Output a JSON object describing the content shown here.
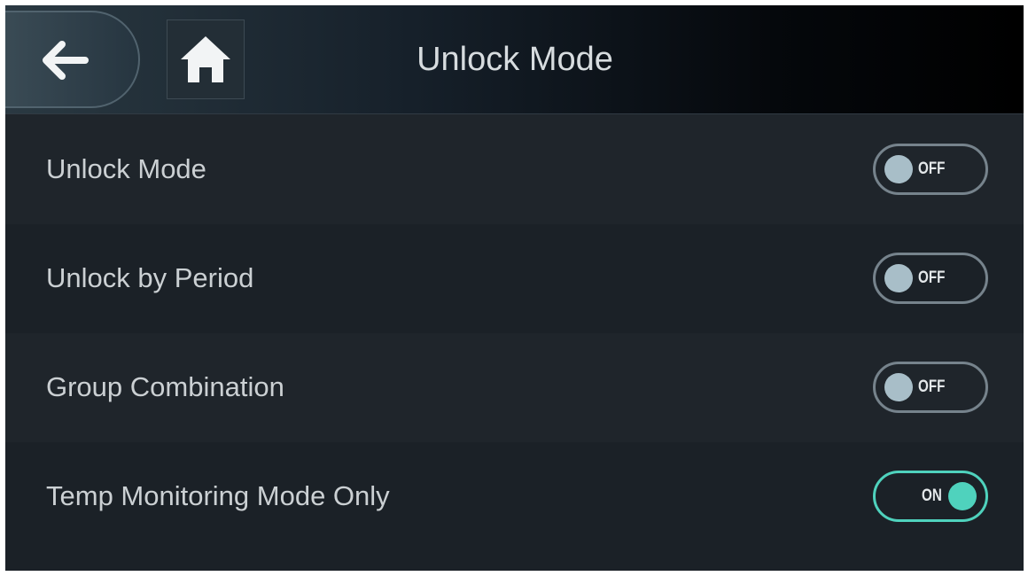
{
  "header": {
    "title": "Unlock Mode",
    "back_icon": "arrow-left-icon",
    "home_icon": "home-icon"
  },
  "settings": [
    {
      "label": "Unlock Mode",
      "state": "OFF",
      "on": false
    },
    {
      "label": "Unlock by Period",
      "state": "OFF",
      "on": false
    },
    {
      "label": "Group Combination",
      "state": "OFF",
      "on": false
    },
    {
      "label": "Temp Monitoring Mode Only",
      "state": "ON",
      "on": true
    }
  ],
  "colors": {
    "accent_on": "#4fd2bd",
    "knob_off": "#a8bec8",
    "background": "#1f252b"
  }
}
